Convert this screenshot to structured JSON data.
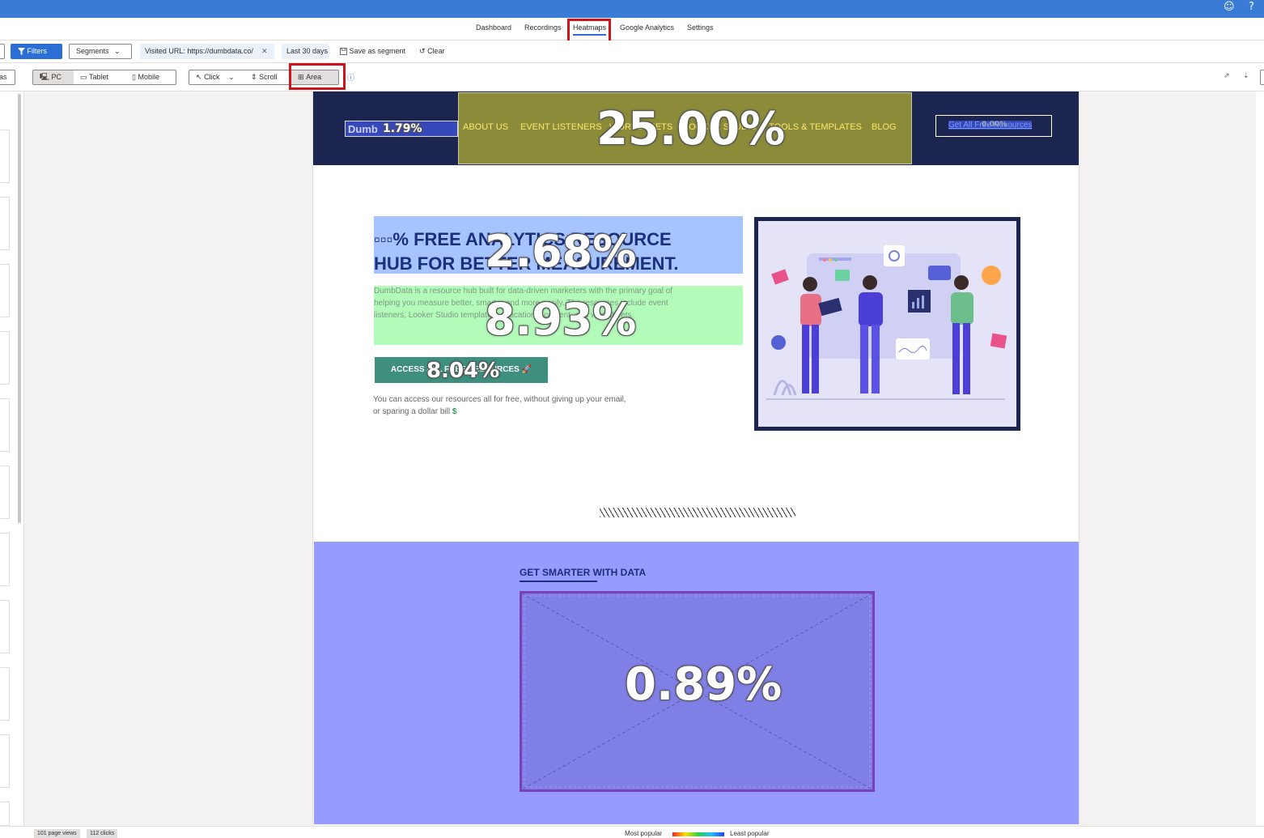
{
  "topbar": {
    "smile_icon": "smiley-icon",
    "help_label": "?"
  },
  "nav": {
    "tabs": [
      {
        "label": "Dashboard"
      },
      {
        "label": "Recordings"
      },
      {
        "label": "Heatmaps",
        "active": true
      },
      {
        "label": "Google Analytics"
      },
      {
        "label": "Settings"
      }
    ]
  },
  "filterbar": {
    "filters_label": "Filters",
    "segments_label": "Segments",
    "url_chip": "Visited URL: https://dumbdata.co/",
    "date_chip": "Last 30 days",
    "save_segment_label": "Save as segment",
    "clear_label": "Clear",
    "left_fragment": "as"
  },
  "toolbar": {
    "devices": [
      "PC",
      "Tablet",
      "Mobile"
    ],
    "selected_device": "PC",
    "modes": [
      "Click",
      "Scroll",
      "Area"
    ],
    "selected_mode": "Area"
  },
  "site": {
    "logo_text": "Dumb",
    "menu": [
      "ABOUT US",
      "EVENT LISTENERS",
      "WORKSHEETS",
      "LOOKER STUDIO",
      "TOOLS & TEMPLATES",
      "BLOG"
    ],
    "header_cta": "Get All Free Resources",
    "hero_title_line1": "▫▫▫% FREE ANALYTICS RESOURCE",
    "hero_title_line2": "HUB FOR BETTER MEASUREMENT.",
    "hero_text": "DumbData is a resource hub built for data-driven marketers with the primary goal of helping you measure better, smarter and more easily. The resources include event listeners, Looker Studio templates, educational content, and worksheets.",
    "cta_label": "ACCESS ALL FREE RESOURCES 🚀",
    "note_text": "You can access our resources all for free, without giving up your email, or sparing a dollar bill",
    "note_emoji": "$",
    "section2_title": "GET SMARTER WITH DATA"
  },
  "areas": {
    "logo": "1.79%",
    "menu": "25.00%",
    "cta_header": "0.00%",
    "hero_title": "2.68%",
    "hero_text": "8.93%",
    "hero_button": "8.04%",
    "video": "0.89%"
  },
  "colors": {
    "accent": "#2b6fd6",
    "highlight_red": "#d0121b",
    "site_navy": "#1b2550",
    "menu_area": "#8b8b3a",
    "title_area": "#a6c4ff",
    "text_area": "#b2fbb9",
    "section_area": "#969cff"
  },
  "status": {
    "page_views": "101 page views",
    "clicks": "112 clicks",
    "legend_most": "Most popular",
    "legend_least": "Least popular"
  }
}
